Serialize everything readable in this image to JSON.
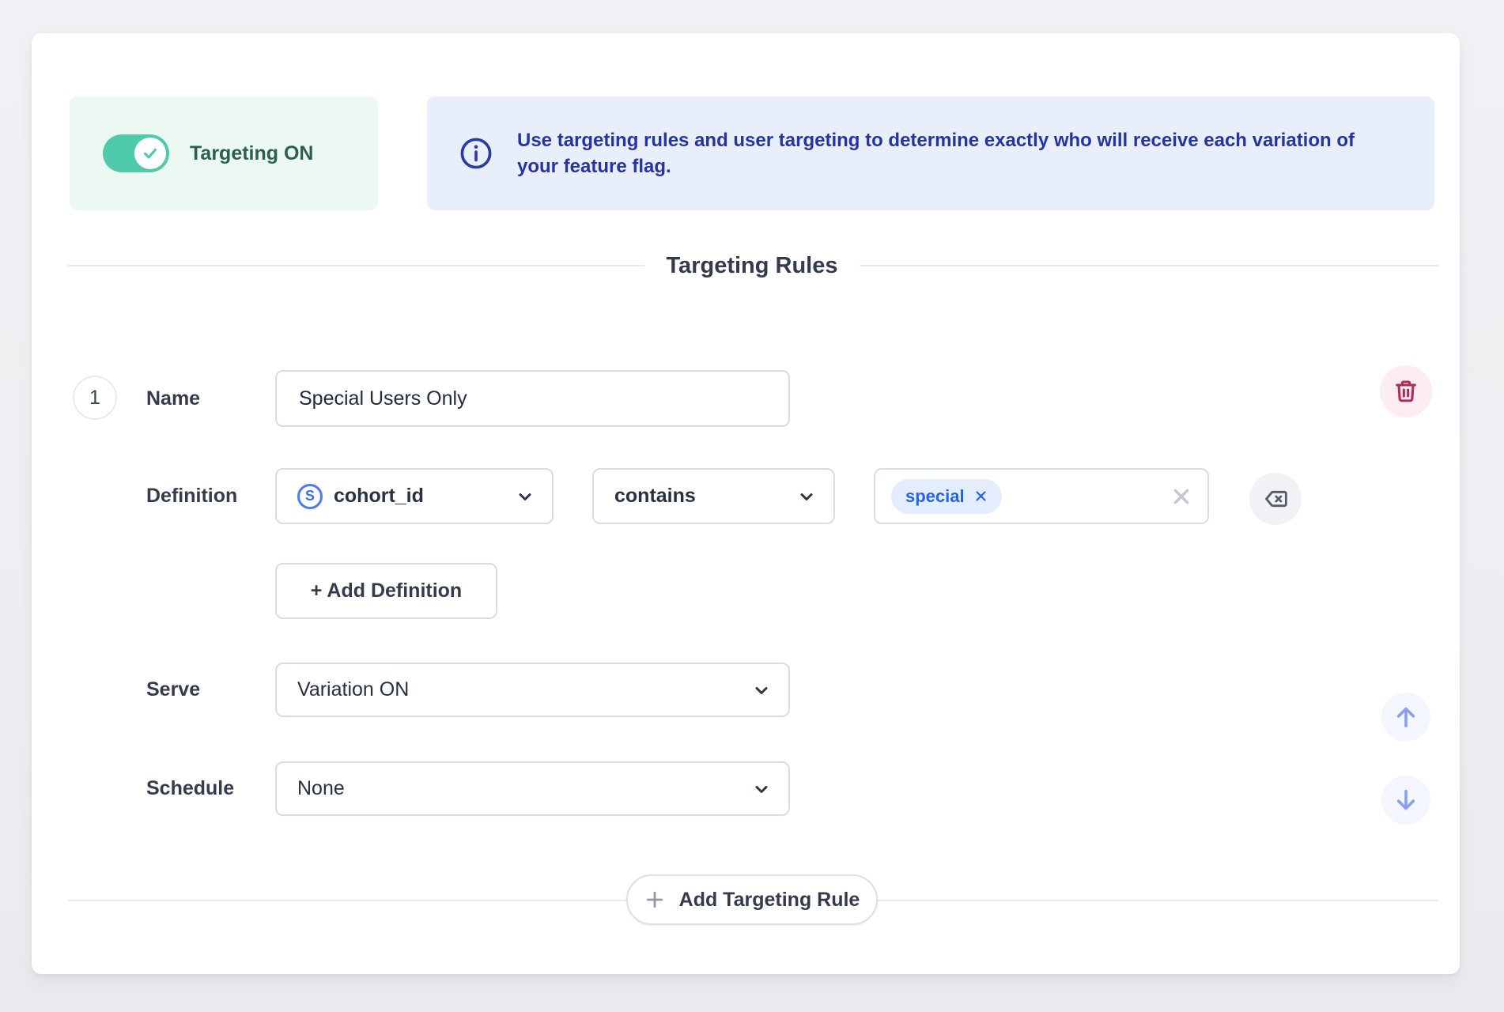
{
  "targeting_panel": {
    "label": "Targeting ON",
    "state": "on"
  },
  "info_banner": {
    "text": "Use targeting rules and user targeting to determine exactly who will receive each variation of your feature flag."
  },
  "section": {
    "title": "Targeting Rules"
  },
  "rule": {
    "number": "1",
    "name": {
      "label": "Name",
      "value": "Special Users Only"
    },
    "definition": {
      "label": "Definition",
      "field": {
        "icon_letter": "S",
        "value": "cohort_id"
      },
      "operator": {
        "value": "contains"
      },
      "values": [
        {
          "label": "special"
        }
      ],
      "add_button_label": "+ Add Definition"
    },
    "serve": {
      "label": "Serve",
      "value": "Variation ON"
    },
    "schedule": {
      "label": "Schedule",
      "value": "None"
    }
  },
  "footer": {
    "add_rule_label": "Add Targeting Rule"
  },
  "colors": {
    "accent_teal": "#4fcbac",
    "teal_text": "#2b5f52",
    "mint_bg": "#ecf9f3",
    "info_bg": "#e9eefb",
    "info_text": "#2534a3",
    "chip_bg": "#e4edfd",
    "chip_text": "#2563eb",
    "danger": "#b12a58",
    "arrow_blue": "#8c9ef0"
  }
}
